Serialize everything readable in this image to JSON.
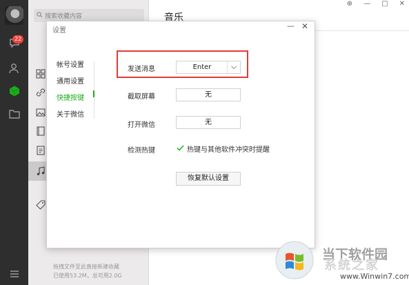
{
  "left_rail": {
    "chat_badge": "22"
  },
  "list_panel": {
    "search_placeholder": "搜索收藏内容",
    "footer_line1": "拖拽文件至此直接新建收藏",
    "footer_line2": "已使用53.2M，总可用2.0G"
  },
  "main_pane": {
    "title": "音乐"
  },
  "window_controls": {
    "pin": "⊕",
    "minimize": "—",
    "maximize": "□",
    "close": "✕"
  },
  "dialog": {
    "title": "设置",
    "minimize_label": "—",
    "close_label": "✕",
    "nav": [
      {
        "label": "帐号设置",
        "active": false
      },
      {
        "label": "通用设置",
        "active": false
      },
      {
        "label": "快捷按键",
        "active": true
      },
      {
        "label": "关于微信",
        "active": false
      }
    ],
    "rows": {
      "send_label": "发送消息",
      "send_value": "Enter",
      "capture_label": "截取屏幕",
      "capture_value": "无",
      "open_label": "打开微信",
      "open_value": "无",
      "hotkey_label": "检测热键",
      "hotkey_checked": true,
      "hotkey_text": "热键与其他软件冲突时提醒"
    },
    "restore_button": "恢复默认设置"
  },
  "watermark": {
    "brand": "当下软件园",
    "tagline": "系统之家",
    "url": "www.Winwin7.com"
  },
  "colors": {
    "accent_green": "#1aad19",
    "highlight_red": "#e53935",
    "rail_bg": "#2e2e2e",
    "badge_red": "#f2433d"
  }
}
